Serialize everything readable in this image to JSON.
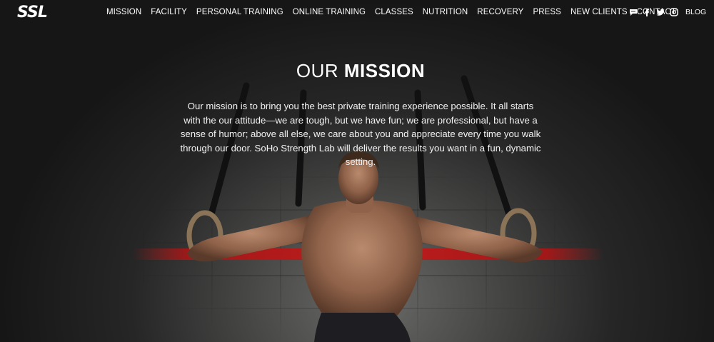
{
  "brand": {
    "logo_text": "SSL"
  },
  "nav": {
    "items": [
      {
        "label": "MISSION"
      },
      {
        "label": "FACILITY"
      },
      {
        "label": "PERSONAL TRAINING"
      },
      {
        "label": "ONLINE TRAINING"
      },
      {
        "label": "CLASSES"
      },
      {
        "label": "NUTRITION"
      },
      {
        "label": "RECOVERY"
      },
      {
        "label": "PRESS"
      },
      {
        "label": "NEW CLIENTS"
      },
      {
        "label": "CONTACT"
      }
    ]
  },
  "social": {
    "icons": [
      "chat-icon",
      "facebook-icon",
      "twitter-icon",
      "instagram-icon"
    ],
    "blog_label": "BLOG"
  },
  "mission": {
    "heading_light": "OUR",
    "heading_bold": "MISSION",
    "body": "Our mission is to bring you the best private training experience possible. It all starts with the our attitude—we are tough, but we have fun; we are professional, but have a sense of humor; above all else, we care about you and appreciate every time you walk through our door. SoHo Strength Lab will deliver the results you want in a fun, dynamic setting."
  },
  "colors": {
    "background": "#1c1c1c",
    "accent_red": "#c11d1d",
    "text": "#ffffff"
  }
}
